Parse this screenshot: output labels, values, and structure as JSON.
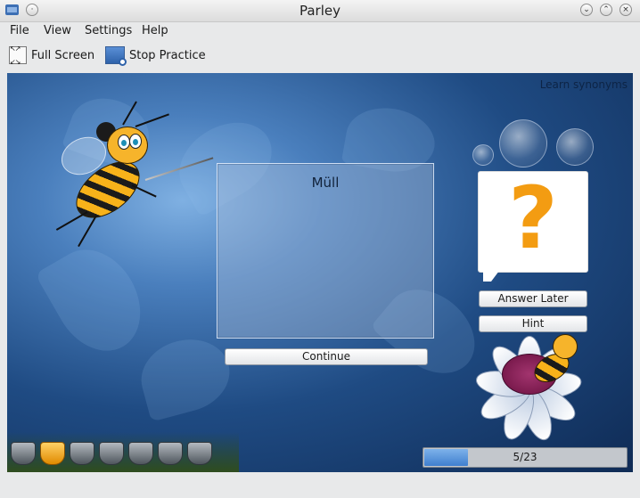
{
  "window": {
    "title": "Parley"
  },
  "menu": {
    "items": [
      "File",
      "View",
      "Settings",
      "Help"
    ]
  },
  "toolbar": {
    "full_screen": "Full Screen",
    "stop_practice": "Stop Practice"
  },
  "practice": {
    "mode_label": "Learn synonyms",
    "question": "Müll",
    "continue_label": "Continue",
    "answer_later_label": "Answer Later",
    "hint_label": "Hint",
    "progress_text": "5/23",
    "progress_fraction": 0.217,
    "score_pots": {
      "filled": 1,
      "total": 7
    }
  },
  "colors": {
    "accent": "#f39c12",
    "progress": "#3f7fcf",
    "background": "#1f4b83"
  },
  "icons": [
    "app-icon",
    "minimize-icon",
    "maximize-icon",
    "close-icon",
    "full-screen-icon",
    "stop-practice-icon",
    "question-mark-icon"
  ]
}
